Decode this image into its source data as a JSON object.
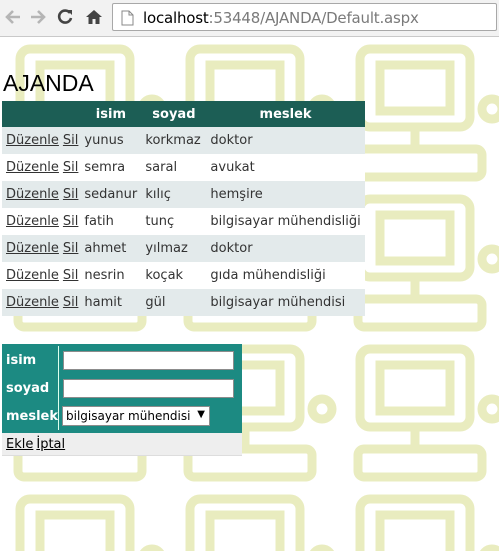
{
  "browser": {
    "url_host": "localhost",
    "url_rest": ":53448/AJANDA/Default.aspx"
  },
  "page": {
    "title": "AJANDA"
  },
  "grid": {
    "headers": [
      "",
      "isim",
      "soyad",
      "meslek"
    ],
    "edit_label": "Düzenle",
    "delete_label": "Sil",
    "rows": [
      {
        "isim": "yunus",
        "soyad": "korkmaz",
        "meslek": "doktor"
      },
      {
        "isim": "semra",
        "soyad": "saral",
        "meslek": "avukat"
      },
      {
        "isim": "sedanur",
        "soyad": "kılıç",
        "meslek": "hemşire"
      },
      {
        "isim": "fatih",
        "soyad": "tunç",
        "meslek": "bilgisayar mühendisliği"
      },
      {
        "isim": "ahmet",
        "soyad": "yılmaz",
        "meslek": "doktor"
      },
      {
        "isim": "nesrin",
        "soyad": "koçak",
        "meslek": "gıda mühendisliği"
      },
      {
        "isim": "hamit",
        "soyad": "gül",
        "meslek": "bilgisayar mühendisi"
      }
    ]
  },
  "form": {
    "isim_label": "isim",
    "soyad_label": "soyad",
    "meslek_label": "meslek",
    "isim_value": "",
    "soyad_value": "",
    "meslek_selected": "bilgisayar mühendisi",
    "add_label": "Ekle",
    "cancel_label": "İptal"
  },
  "colors": {
    "header_bg": "#1c5e55",
    "form_bg": "#1c8a82",
    "alt_row_bg": "#e3eaeb",
    "bg_pattern": "#e9ecbf"
  }
}
